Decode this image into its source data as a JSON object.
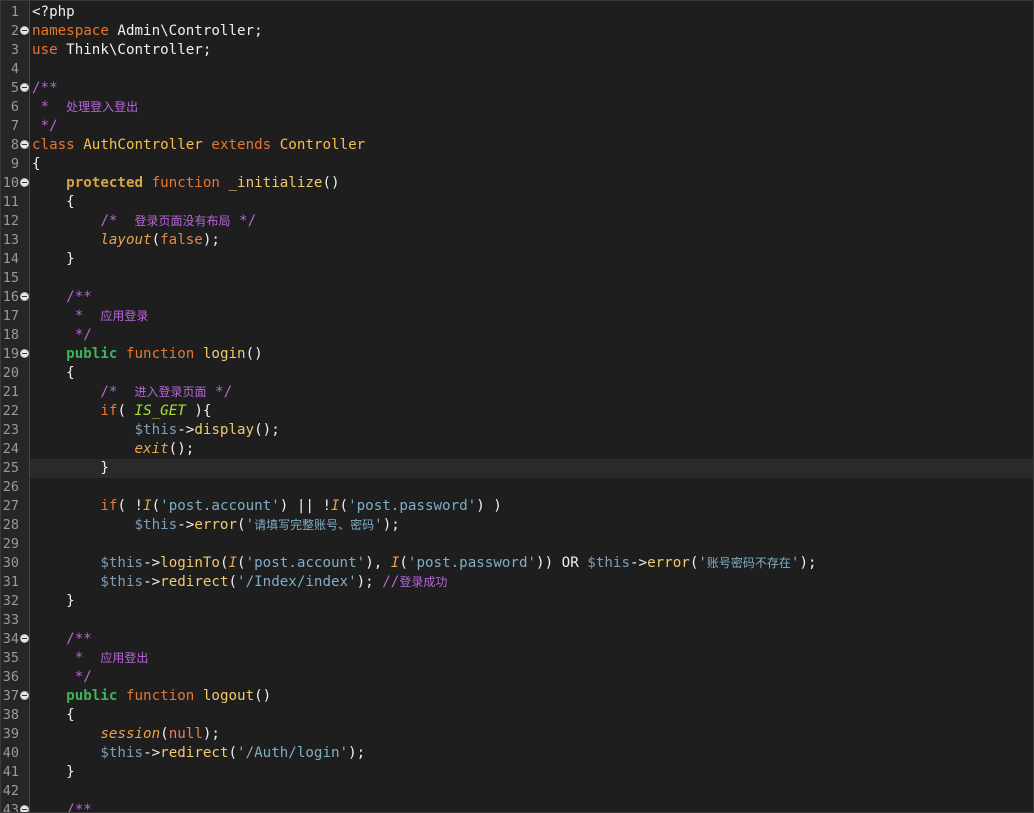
{
  "editor": {
    "current_line": 25,
    "lines": [
      {
        "n": "1",
        "fold": false,
        "tokens": [
          {
            "t": "<?php",
            "c": "plain"
          }
        ]
      },
      {
        "n": "2",
        "fold": true,
        "tokens": [
          {
            "t": "namespace",
            "c": "kw"
          },
          {
            "t": " Admin\\Controller;",
            "c": "plain"
          }
        ]
      },
      {
        "n": "3",
        "fold": false,
        "tokens": [
          {
            "t": "use",
            "c": "kw"
          },
          {
            "t": " Think\\Controller;",
            "c": "plain"
          }
        ]
      },
      {
        "n": "4",
        "fold": false,
        "tokens": []
      },
      {
        "n": "5",
        "fold": true,
        "tokens": [
          {
            "t": "/**",
            "c": "cm"
          }
        ]
      },
      {
        "n": "6",
        "fold": false,
        "tokens": [
          {
            "t": " *  ",
            "c": "cm"
          },
          {
            "t": "处理登入登出",
            "c": "cm cn"
          }
        ]
      },
      {
        "n": "7",
        "fold": false,
        "tokens": [
          {
            "t": " */",
            "c": "cm"
          }
        ]
      },
      {
        "n": "8",
        "fold": true,
        "tokens": [
          {
            "t": "class",
            "c": "kw"
          },
          {
            "t": " ",
            "c": "plain"
          },
          {
            "t": "AuthController",
            "c": "cls"
          },
          {
            "t": " ",
            "c": "plain"
          },
          {
            "t": "extends",
            "c": "kw"
          },
          {
            "t": " ",
            "c": "plain"
          },
          {
            "t": "Controller",
            "c": "cls"
          }
        ]
      },
      {
        "n": "9",
        "fold": false,
        "tokens": [
          {
            "t": "{",
            "c": "plain"
          }
        ]
      },
      {
        "n": "10",
        "fold": true,
        "tokens": [
          {
            "t": "    ",
            "c": "plain"
          },
          {
            "t": "protected",
            "c": "mod"
          },
          {
            "t": " ",
            "c": "plain"
          },
          {
            "t": "function",
            "c": "kw"
          },
          {
            "t": " ",
            "c": "plain"
          },
          {
            "t": "_initialize",
            "c": "fn"
          },
          {
            "t": "()",
            "c": "plain"
          }
        ]
      },
      {
        "n": "11",
        "fold": false,
        "tokens": [
          {
            "t": "    {",
            "c": "plain"
          }
        ]
      },
      {
        "n": "12",
        "fold": false,
        "tokens": [
          {
            "t": "        /*  ",
            "c": "cm"
          },
          {
            "t": "登录页面没有布局",
            "c": "cm cn"
          },
          {
            "t": " */",
            "c": "cm"
          }
        ]
      },
      {
        "n": "13",
        "fold": false,
        "tokens": [
          {
            "t": "        ",
            "c": "plain"
          },
          {
            "t": "layout",
            "c": "call"
          },
          {
            "t": "(",
            "c": "plain"
          },
          {
            "t": "false",
            "c": "bool"
          },
          {
            "t": ");",
            "c": "plain"
          }
        ]
      },
      {
        "n": "14",
        "fold": false,
        "tokens": [
          {
            "t": "    }",
            "c": "plain"
          }
        ]
      },
      {
        "n": "15",
        "fold": false,
        "tokens": []
      },
      {
        "n": "16",
        "fold": true,
        "tokens": [
          {
            "t": "    /**",
            "c": "cm"
          }
        ]
      },
      {
        "n": "17",
        "fold": false,
        "tokens": [
          {
            "t": "     *  ",
            "c": "cm"
          },
          {
            "t": "应用登录",
            "c": "cm cn"
          }
        ]
      },
      {
        "n": "18",
        "fold": false,
        "tokens": [
          {
            "t": "     */",
            "c": "cm"
          }
        ]
      },
      {
        "n": "19",
        "fold": true,
        "tokens": [
          {
            "t": "    ",
            "c": "plain"
          },
          {
            "t": "public",
            "c": "pub"
          },
          {
            "t": " ",
            "c": "plain"
          },
          {
            "t": "function",
            "c": "kw"
          },
          {
            "t": " ",
            "c": "plain"
          },
          {
            "t": "login",
            "c": "fn"
          },
          {
            "t": "()",
            "c": "plain"
          }
        ]
      },
      {
        "n": "20",
        "fold": false,
        "tokens": [
          {
            "t": "    {",
            "c": "plain"
          }
        ]
      },
      {
        "n": "21",
        "fold": false,
        "tokens": [
          {
            "t": "        /*  ",
            "c": "cm"
          },
          {
            "t": "进入登录页面",
            "c": "cm cn"
          },
          {
            "t": " */",
            "c": "cm"
          }
        ]
      },
      {
        "n": "22",
        "fold": false,
        "tokens": [
          {
            "t": "        ",
            "c": "plain"
          },
          {
            "t": "if",
            "c": "kw"
          },
          {
            "t": "( ",
            "c": "plain"
          },
          {
            "t": "IS_GET",
            "c": "const"
          },
          {
            "t": " ){",
            "c": "plain"
          }
        ]
      },
      {
        "n": "23",
        "fold": false,
        "tokens": [
          {
            "t": "            ",
            "c": "plain"
          },
          {
            "t": "$this",
            "c": "var"
          },
          {
            "t": "->",
            "c": "plain"
          },
          {
            "t": "display",
            "c": "fn"
          },
          {
            "t": "();",
            "c": "plain"
          }
        ]
      },
      {
        "n": "24",
        "fold": false,
        "tokens": [
          {
            "t": "            ",
            "c": "plain"
          },
          {
            "t": "exit",
            "c": "call"
          },
          {
            "t": "();",
            "c": "plain"
          }
        ]
      },
      {
        "n": "25",
        "fold": false,
        "tokens": [
          {
            "t": "        }",
            "c": "plain"
          }
        ]
      },
      {
        "n": "26",
        "fold": false,
        "tokens": []
      },
      {
        "n": "27",
        "fold": false,
        "tokens": [
          {
            "t": "        ",
            "c": "plain"
          },
          {
            "t": "if",
            "c": "kw"
          },
          {
            "t": "( !",
            "c": "plain"
          },
          {
            "t": "I",
            "c": "call"
          },
          {
            "t": "(",
            "c": "plain"
          },
          {
            "t": "'post.account'",
            "c": "str"
          },
          {
            "t": ") || !",
            "c": "plain"
          },
          {
            "t": "I",
            "c": "call"
          },
          {
            "t": "(",
            "c": "plain"
          },
          {
            "t": "'post.password'",
            "c": "str"
          },
          {
            "t": ") )",
            "c": "plain"
          }
        ]
      },
      {
        "n": "28",
        "fold": false,
        "tokens": [
          {
            "t": "            ",
            "c": "plain"
          },
          {
            "t": "$this",
            "c": "var"
          },
          {
            "t": "->",
            "c": "plain"
          },
          {
            "t": "error",
            "c": "fn"
          },
          {
            "t": "(",
            "c": "plain"
          },
          {
            "t": "'",
            "c": "str"
          },
          {
            "t": "请填写完整账号、密码",
            "c": "str cn"
          },
          {
            "t": "'",
            "c": "str"
          },
          {
            "t": ");",
            "c": "plain"
          }
        ]
      },
      {
        "n": "29",
        "fold": false,
        "tokens": []
      },
      {
        "n": "30",
        "fold": false,
        "tokens": [
          {
            "t": "        ",
            "c": "plain"
          },
          {
            "t": "$this",
            "c": "var"
          },
          {
            "t": "->",
            "c": "plain"
          },
          {
            "t": "loginTo",
            "c": "fn"
          },
          {
            "t": "(",
            "c": "plain"
          },
          {
            "t": "I",
            "c": "call"
          },
          {
            "t": "(",
            "c": "plain"
          },
          {
            "t": "'post.account'",
            "c": "str"
          },
          {
            "t": "), ",
            "c": "plain"
          },
          {
            "t": "I",
            "c": "call"
          },
          {
            "t": "(",
            "c": "plain"
          },
          {
            "t": "'post.password'",
            "c": "str"
          },
          {
            "t": ")) OR ",
            "c": "plain"
          },
          {
            "t": "$this",
            "c": "var"
          },
          {
            "t": "->",
            "c": "plain"
          },
          {
            "t": "error",
            "c": "fn"
          },
          {
            "t": "(",
            "c": "plain"
          },
          {
            "t": "'",
            "c": "str"
          },
          {
            "t": "账号密码不存在",
            "c": "str cn"
          },
          {
            "t": "'",
            "c": "str"
          },
          {
            "t": ");",
            "c": "plain"
          }
        ]
      },
      {
        "n": "31",
        "fold": false,
        "tokens": [
          {
            "t": "        ",
            "c": "plain"
          },
          {
            "t": "$this",
            "c": "var"
          },
          {
            "t": "->",
            "c": "plain"
          },
          {
            "t": "redirect",
            "c": "fn"
          },
          {
            "t": "(",
            "c": "plain"
          },
          {
            "t": "'/Index/index'",
            "c": "str"
          },
          {
            "t": "); ",
            "c": "plain"
          },
          {
            "t": "//",
            "c": "cm"
          },
          {
            "t": "登录成功",
            "c": "cm cn"
          }
        ]
      },
      {
        "n": "32",
        "fold": false,
        "tokens": [
          {
            "t": "    }",
            "c": "plain"
          }
        ]
      },
      {
        "n": "33",
        "fold": false,
        "tokens": []
      },
      {
        "n": "34",
        "fold": true,
        "tokens": [
          {
            "t": "    /**",
            "c": "cm"
          }
        ]
      },
      {
        "n": "35",
        "fold": false,
        "tokens": [
          {
            "t": "     *  ",
            "c": "cm"
          },
          {
            "t": "应用登出",
            "c": "cm cn"
          }
        ]
      },
      {
        "n": "36",
        "fold": false,
        "tokens": [
          {
            "t": "     */",
            "c": "cm"
          }
        ]
      },
      {
        "n": "37",
        "fold": true,
        "tokens": [
          {
            "t": "    ",
            "c": "plain"
          },
          {
            "t": "public",
            "c": "pub"
          },
          {
            "t": " ",
            "c": "plain"
          },
          {
            "t": "function",
            "c": "kw"
          },
          {
            "t": " ",
            "c": "plain"
          },
          {
            "t": "logout",
            "c": "fn"
          },
          {
            "t": "()",
            "c": "plain"
          }
        ]
      },
      {
        "n": "38",
        "fold": false,
        "tokens": [
          {
            "t": "    {",
            "c": "plain"
          }
        ]
      },
      {
        "n": "39",
        "fold": false,
        "tokens": [
          {
            "t": "        ",
            "c": "plain"
          },
          {
            "t": "session",
            "c": "call"
          },
          {
            "t": "(",
            "c": "plain"
          },
          {
            "t": "null",
            "c": "bool"
          },
          {
            "t": ");",
            "c": "plain"
          }
        ]
      },
      {
        "n": "40",
        "fold": false,
        "tokens": [
          {
            "t": "        ",
            "c": "plain"
          },
          {
            "t": "$this",
            "c": "var"
          },
          {
            "t": "->",
            "c": "plain"
          },
          {
            "t": "redirect",
            "c": "fn"
          },
          {
            "t": "(",
            "c": "plain"
          },
          {
            "t": "'/Auth/login'",
            "c": "str"
          },
          {
            "t": ");",
            "c": "plain"
          }
        ]
      },
      {
        "n": "41",
        "fold": false,
        "tokens": [
          {
            "t": "    }",
            "c": "plain"
          }
        ]
      },
      {
        "n": "42",
        "fold": false,
        "tokens": []
      },
      {
        "n": "43",
        "fold": true,
        "tokens": [
          {
            "t": "    /**",
            "c": "cm"
          }
        ]
      }
    ]
  }
}
